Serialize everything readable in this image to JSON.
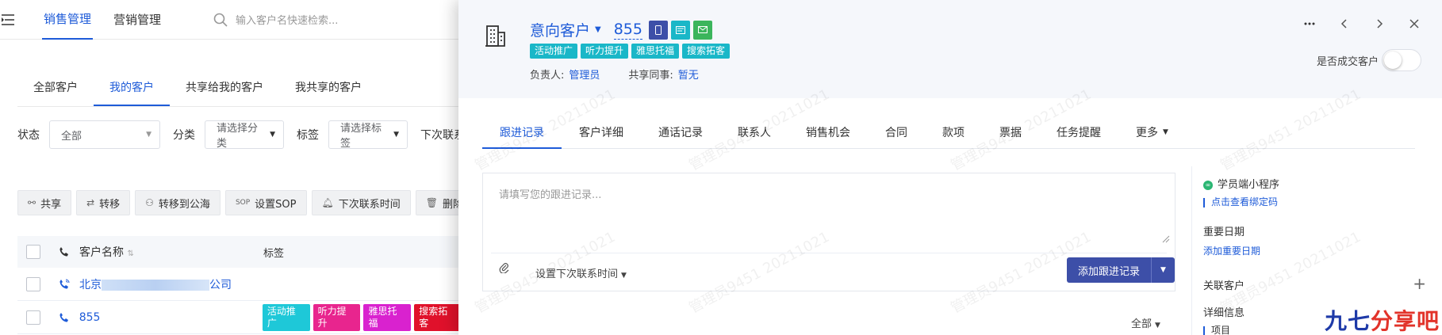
{
  "topnav": {
    "items": [
      {
        "label": "销售管理",
        "active": true
      },
      {
        "label": "营销管理",
        "active": false
      }
    ],
    "search_placeholder": "输入客户名快速检索..."
  },
  "subtabs": [
    "全部客户",
    "我的客户",
    "共享给我的客户",
    "我共享的客户"
  ],
  "subtabs_active_index": 1,
  "filters": {
    "status_label": "状态",
    "status_value": "全部",
    "category_label": "分类",
    "category_value": "请选择分类",
    "tag_label": "标签",
    "tag_value": "请选择标签",
    "next_contact_label": "下次联系"
  },
  "actions": [
    {
      "label": "共享",
      "icon": "share-icon"
    },
    {
      "label": "转移",
      "icon": "transfer-icon"
    },
    {
      "label": "转移到公海",
      "icon": "pool-icon"
    },
    {
      "label": "设置SOP",
      "icon": "sop-icon"
    },
    {
      "label": "下次联系时间",
      "icon": "bell-icon"
    },
    {
      "label": "删除",
      "icon": "trash-icon"
    }
  ],
  "table": {
    "headers": {
      "name": "客户名称",
      "tags": "标签"
    },
    "rows": [
      {
        "name_prefix": "北京",
        "name_suffix": "公司",
        "tags": []
      },
      {
        "name": "855",
        "tags": [
          {
            "label": "活动推广",
            "color": "#1ec8d8"
          },
          {
            "label": "听力提升",
            "color": "#e8258e"
          },
          {
            "label": "雅思托福",
            "color": "#d922cf"
          },
          {
            "label": "搜索拓客",
            "color": "#e0112b"
          }
        ]
      }
    ]
  },
  "drawer": {
    "stage": "意向客户",
    "customer_name": "855",
    "header_tags": [
      "活动推广",
      "听力提升",
      "雅思托福",
      "搜索拓客"
    ],
    "owner_label": "负责人:",
    "owner_value": "管理员",
    "share_label": "共享同事:",
    "share_value": "暂无",
    "deal_label": "是否成交客户",
    "tabs": [
      "跟进记录",
      "客户详细",
      "通话记录",
      "联系人",
      "销售机会",
      "合同",
      "款项",
      "票据",
      "任务提醒",
      "更多"
    ],
    "active_tab_index": 0,
    "editor_placeholder": "请填写您的跟进记录...",
    "next_contact": "设置下次联系时间",
    "add_button": "添加跟进记录",
    "filter_all": "全部",
    "side": {
      "mini_program": "学员端小程序",
      "bind_code": "点击查看绑定码",
      "important_date": "重要日期",
      "add_important_date": "添加重要日期",
      "related_customer": "关联客户",
      "detail_info": "详细信息",
      "project": "项目"
    },
    "colors": {
      "accent": "#1e5bd8",
      "tag": "#1ab7c8",
      "primary_button": "#3d4fa8",
      "phone": "#3d4fa8",
      "message": "#1ab7c8",
      "mail": "#3bb55c"
    }
  },
  "watermark_text": "管理员9451 20211021",
  "brand": {
    "part1": "九七",
    "part2": "分享吧"
  }
}
